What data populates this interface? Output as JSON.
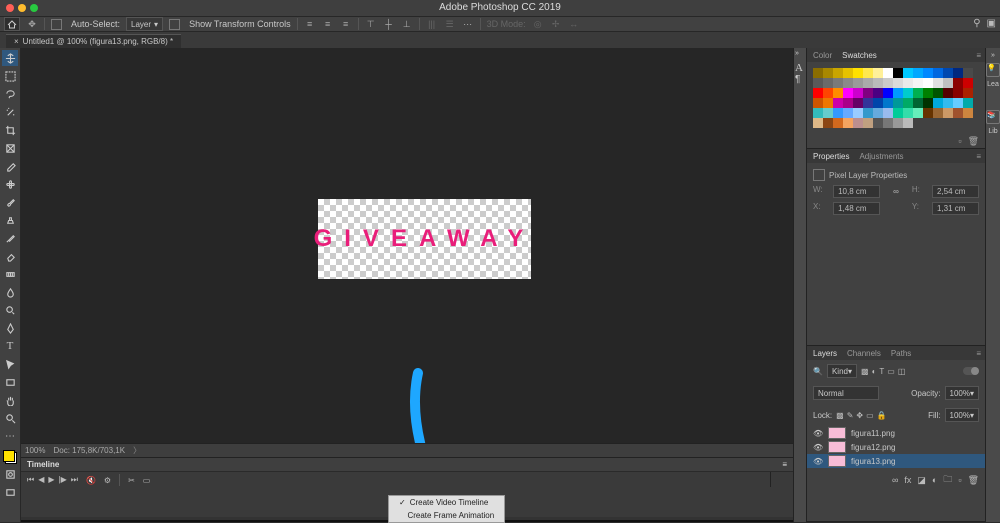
{
  "app": {
    "title": "Adobe Photoshop CC 2019"
  },
  "mac_dots": [
    "#ff5f57",
    "#ffbd2e",
    "#28c940"
  ],
  "options_bar": {
    "auto_select_label": "Auto-Select:",
    "auto_select_value": "Layer",
    "show_transform": "Show Transform Controls",
    "threed_label": "3D Mode:"
  },
  "document_tab": {
    "title": "Untitled1 @ 100% (figura13.png, RGB/8) *"
  },
  "canvas": {
    "text": "GIVEAWAY"
  },
  "status": {
    "zoom": "100%",
    "doc": "Doc: 175,8K/703,1K"
  },
  "timeline": {
    "title": "Timeline",
    "menu_create_video": "Create Video Timeline",
    "menu_create_frame": "Create Frame Animation"
  },
  "panels": {
    "color_tab": "Color",
    "swatches_tab": "Swatches",
    "properties_tab": "Properties",
    "adjustments_tab": "Adjustments",
    "layers_tab": "Layers",
    "channels_tab": "Channels",
    "paths_tab": "Paths"
  },
  "swatch_colors": [
    "#8a6d00",
    "#a88800",
    "#c9a500",
    "#e6c200",
    "#ffe100",
    "#ffe84d",
    "#fff099",
    "#ffffff",
    "#000000",
    "#00c8ff",
    "#00a8ff",
    "#0088ff",
    "#0068e0",
    "#0048b0",
    "#002880",
    "#4a4a4a",
    "#5a5a5a",
    "#6a6a6a",
    "#7a7a7a",
    "#8a8a8a",
    "#9a9a9a",
    "#aaaaaa",
    "#bababa",
    "#cacaca",
    "#dadada",
    "#eaeaea",
    "#f5f5f5",
    "#fefefe",
    "#e0e0e0",
    "#c0c0c0",
    "#8b0000",
    "#cd0000",
    "#ff0000",
    "#ff4500",
    "#ff8c00",
    "#ff00ff",
    "#cc00cc",
    "#800080",
    "#4b0082",
    "#0000ff",
    "#0099ff",
    "#00cccc",
    "#00b050",
    "#008000",
    "#005500",
    "#550000",
    "#880000",
    "#aa2200",
    "#cc5500",
    "#ee7700",
    "#cc00aa",
    "#aa0088",
    "#660066",
    "#333399",
    "#0044aa",
    "#0077cc",
    "#009999",
    "#00aa66",
    "#006633",
    "#003300",
    "#00aadd",
    "#33bbee",
    "#66ccff",
    "#00aaaa",
    "#33bbbb",
    "#66cccc",
    "#3399ff",
    "#66aaff",
    "#99ccff",
    "#3399cc",
    "#66aadd",
    "#99bbee",
    "#00cc99",
    "#33ddaa",
    "#66eebb",
    "#663300",
    "#996633",
    "#cc9966",
    "#a0522d",
    "#cd853f",
    "#deb887",
    "#8b4513",
    "#d2691e",
    "#f4a460",
    "#bc8f8f",
    "#c0a080",
    "#555555",
    "#777777",
    "#999999",
    "#bbbbbb"
  ],
  "properties": {
    "header": "Pixel Layer Properties",
    "w_label": "W:",
    "w_value": "10,8 cm",
    "h_label": "H:",
    "h_value": "2,54 cm",
    "x_label": "X:",
    "x_value": "1,48 cm",
    "y_label": "Y:",
    "y_value": "1,31 cm"
  },
  "layers_panel": {
    "kind_label": "Kind",
    "blend_mode": "Normal",
    "opacity_label": "Opacity:",
    "opacity_value": "100%",
    "lock_label": "Lock:",
    "fill_label": "Fill:",
    "fill_value": "100%",
    "layers": [
      {
        "name": "figura11.png",
        "selected": false
      },
      {
        "name": "figura12.png",
        "selected": false
      },
      {
        "name": "figura13.png",
        "selected": true
      }
    ]
  },
  "collapsed_panels": {
    "learn": "Lea",
    "libraries": "Lib"
  },
  "side_letters": [
    "A",
    "¶"
  ]
}
